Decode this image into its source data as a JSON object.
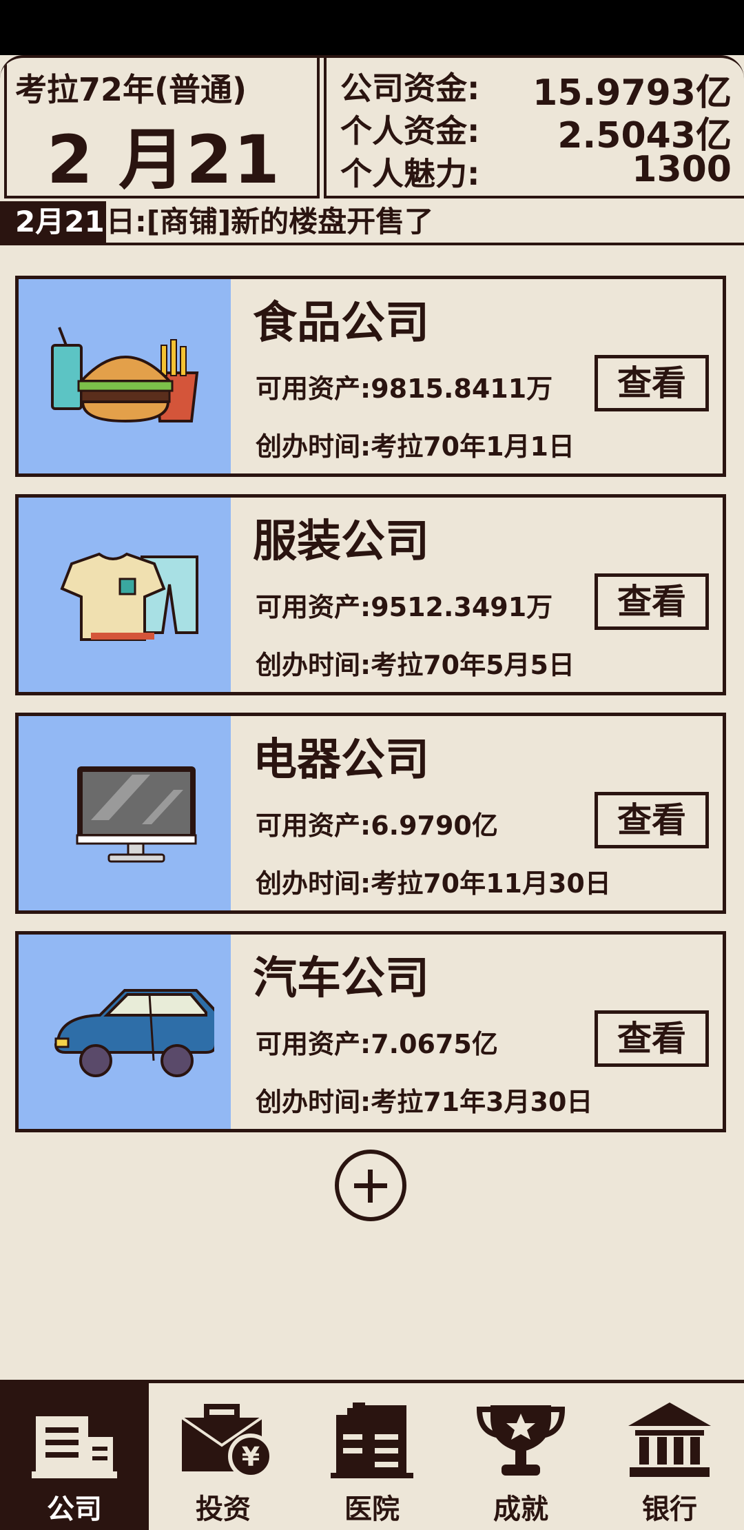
{
  "header": {
    "era": "考拉72年(普通)",
    "date": "2 月21 日",
    "stats": [
      {
        "label": "公司资金:",
        "value": "15.9793亿"
      },
      {
        "label": "个人资金:",
        "value": "2.5043亿"
      },
      {
        "label": "个人魅力:",
        "value": "1300"
      }
    ]
  },
  "ticker": {
    "badge": "2月21",
    "message": "日:[商铺]新的楼盘开售了"
  },
  "companies": [
    {
      "name": "食品公司",
      "assets": "可用资产:9815.8411万",
      "founded": "创办时间:考拉70年1月1日",
      "button": "查看",
      "icon": "food-icon"
    },
    {
      "name": "服装公司",
      "assets": "可用资产:9512.3491万",
      "founded": "创办时间:考拉70年5月5日",
      "button": "查看",
      "icon": "clothing-icon"
    },
    {
      "name": "电器公司",
      "assets": "可用资产:6.9790亿",
      "founded": "创办时间:考拉70年11月30日",
      "button": "查看",
      "icon": "computer-icon"
    },
    {
      "name": "汽车公司",
      "assets": "可用资产:7.0675亿",
      "founded": "创办时间:考拉71年3月30日",
      "button": "查看",
      "icon": "car-icon"
    }
  ],
  "nav": [
    {
      "label": "公司",
      "icon": "office-building-icon",
      "active": true
    },
    {
      "label": "投资",
      "icon": "briefcase-yen-icon",
      "active": false
    },
    {
      "label": "医院",
      "icon": "hospital-icon",
      "active": false
    },
    {
      "label": "成就",
      "icon": "trophy-icon",
      "active": false
    },
    {
      "label": "银行",
      "icon": "bank-icon",
      "active": false
    }
  ],
  "colors": {
    "dark": "#2a1410",
    "background": "#ede6d8",
    "card_image_bg": "#92b8f4"
  }
}
